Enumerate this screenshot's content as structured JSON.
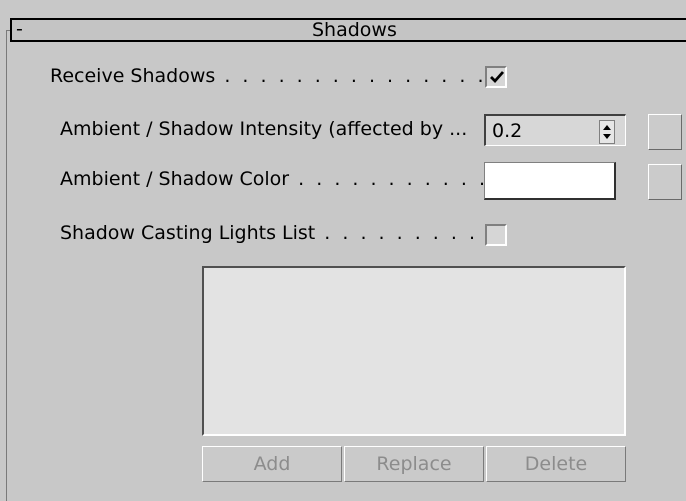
{
  "rollout": {
    "collapse_symbol": "-",
    "title": "Shadows"
  },
  "receive_shadows": {
    "label": "Receive Shadows",
    "dots": " . . . . . . . . . . . . . . . . . . . . . .",
    "checked": true
  },
  "ambient_intensity": {
    "label": "Ambient / Shadow Intensity (affected by ...",
    "value": "0.2"
  },
  "ambient_color": {
    "label": "Ambient / Shadow Color",
    "dots": " . . . . . . . . . . . . . .",
    "color": "#ffffff"
  },
  "shadow_casting_lights": {
    "label": "Shadow Casting Lights List",
    "dots": " . . . . . . . . . . . .",
    "checked": false
  },
  "list_buttons": {
    "add": "Add",
    "replace": "Replace",
    "delete": "Delete"
  }
}
